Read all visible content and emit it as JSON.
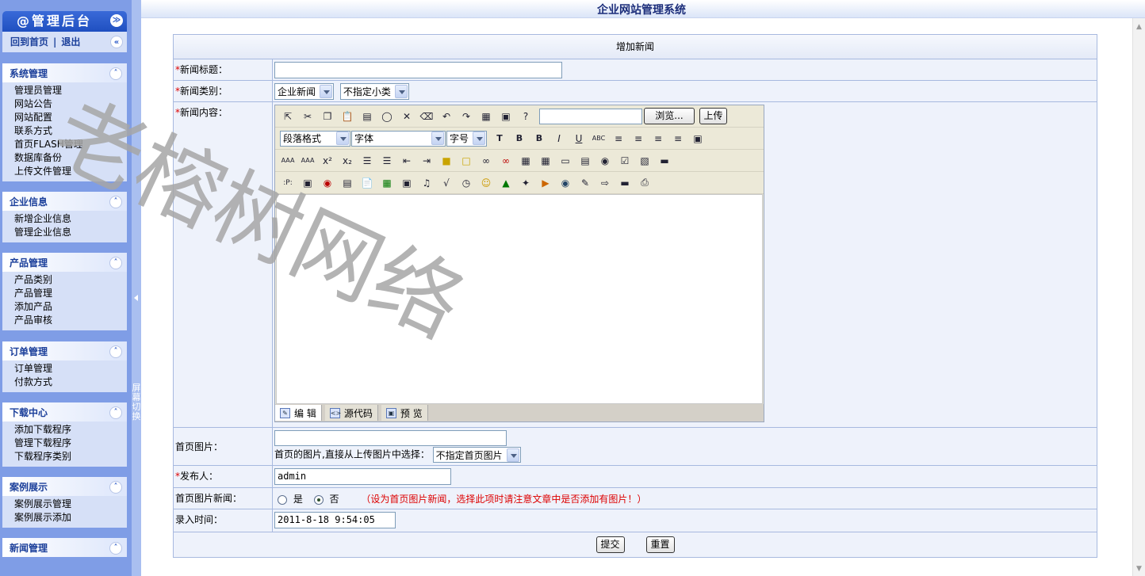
{
  "app": {
    "title": "企业网站管理系统"
  },
  "sidebar": {
    "header": "@管理后台",
    "links": {
      "home": "回到首页",
      "logout": "退出"
    },
    "groups": [
      {
        "title": "系统管理",
        "items": [
          "管理员管理",
          "网站公告",
          "网站配置",
          "联系方式",
          "首页FLASH管理",
          "数据库备份",
          "上传文件管理"
        ]
      },
      {
        "title": "企业信息",
        "items": [
          "新增企业信息",
          "管理企业信息"
        ]
      },
      {
        "title": "产品管理",
        "items": [
          "产品类别",
          "产品管理",
          "添加产品",
          "产品审核"
        ]
      },
      {
        "title": "订单管理",
        "items": [
          "订单管理",
          "付款方式"
        ]
      },
      {
        "title": "下载中心",
        "items": [
          "添加下载程序",
          "管理下载程序",
          "下载程序类别"
        ]
      },
      {
        "title": "案例展示",
        "items": [
          "案例展示管理",
          "案例展示添加"
        ]
      },
      {
        "title": "新闻管理",
        "items": []
      }
    ],
    "splitter_text": "屏幕切换"
  },
  "form": {
    "heading": "增加新闻",
    "title_label": "新闻标题：",
    "title_value": "",
    "category_label": "新闻类别：",
    "category_value": "企业新闻",
    "subcategory_value": "不指定小类",
    "content_label": "新闻内容：",
    "editor": {
      "paragraph_select": "段落格式",
      "font_select": "字体",
      "size_select": "字号",
      "browse_button": "浏览...",
      "upload_button": "上传",
      "tabs": [
        "编 辑",
        "源代码",
        "预 览"
      ]
    },
    "image_label": "首页图片：",
    "image_value": "",
    "image_hint": "首页的图片,直接从上传图片中选择：",
    "image_select": "不指定首页图片",
    "author_label": "发布人：",
    "author_value": "admin",
    "image_news_label": "首页图片新闻：",
    "image_news_yes": "是",
    "image_news_no": "否",
    "image_news_selected": "否",
    "image_news_warning": "（设为首页图片新闻，选择此项时请注意文章中是否添加有图片！）",
    "time_label": "录入时间：",
    "time_value": "2011-8-18 9:54:05",
    "submit_label": "提交",
    "reset_label": "重置"
  },
  "watermark": {
    "text": "老榕树网络"
  }
}
